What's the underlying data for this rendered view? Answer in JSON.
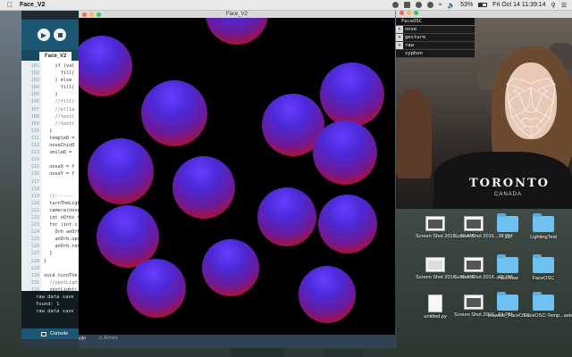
{
  "menubar": {
    "app_name": "Face_V2",
    "battery": "53%",
    "clock": "Fri Oct 14  11:39:14"
  },
  "editor": {
    "tab_label": "Face_V2",
    "gutter": [
      "101",
      "102",
      "103",
      "104",
      "105",
      "106",
      "107",
      "108",
      "109",
      "110",
      "111",
      "112",
      "113",
      "114",
      "115",
      "116",
      "117",
      "118",
      "119",
      "120",
      "121",
      "122",
      "123",
      "124",
      "125",
      "126",
      "127",
      "128",
      "129",
      "130",
      "131",
      "132"
    ],
    "code_lines": [
      "    if (val",
      "      fill(",
      "    } else",
      "      fill(",
      "    }",
      "    //fill(",
      "    //ellip",
      "    //text(",
      "    //text(",
      "  }",
      "  templeD =",
      "  noseChinD",
      "  smileD =",
      "",
      "  noseX = f",
      "  noseY = f",
      "",
      "",
      "  //-------",
      "  turnTheLigh",
      "  camera(nose",
      "  int nOrbs =",
      "  for (int i",
      "    Orb anOrb",
      "    anOrb.upd",
      "    anOrb.ren",
      "  }",
      "}",
      "",
      "void turnThe",
      "  //spotLigh",
      "  spotLight(",
      "  spotLight("
    ],
    "console_lines": [
      "raw data saved",
      "found: 1",
      "raw data saved"
    ],
    "console_tab": "Console"
  },
  "consolebar": {
    "console_tab": "Console",
    "errors_tab": "Errors"
  },
  "sketch": {
    "title": "Face_V2"
  },
  "face": {
    "title": "",
    "panel_title": "FaceOSC",
    "options": [
      "nose",
      "gesture",
      "raw",
      "syphon"
    ],
    "shirt_text": "TORONTO",
    "shirt_sub": "CANADA"
  },
  "desktop": {
    "icons": [
      {
        "label": "Screen Shot 2016...33 AM",
        "type": "screenshot-dark"
      },
      {
        "label": "Screen Shot 2016...38 PM",
        "type": "screenshot-dark"
      },
      {
        "label": "3D",
        "type": "folder"
      },
      {
        "label": "LightingTest",
        "type": "folder"
      },
      {
        "label": "Screen Shot 2016...35 AM",
        "type": "screenshot-light"
      },
      {
        "label": "Screen Shot 2016...48 PM",
        "type": "screenshot-dark"
      },
      {
        "label": "FaceRaw",
        "type": "folder"
      },
      {
        "label": "FaceOSC",
        "type": "folder"
      },
      {
        "label": "untitled.py",
        "type": "document"
      },
      {
        "label": "Screen Shot 2016...01 PM",
        "type": "screenshot-dark"
      },
      {
        "label": "krawleb_FaceOSC",
        "type": "folder"
      },
      {
        "label": "FaceOSC-Temp...aster",
        "type": "folder"
      }
    ]
  },
  "colors": {
    "orb_top": "#5b34f0",
    "orb_bottom": "#c8101c",
    "processing_blue": "#1c5873"
  }
}
